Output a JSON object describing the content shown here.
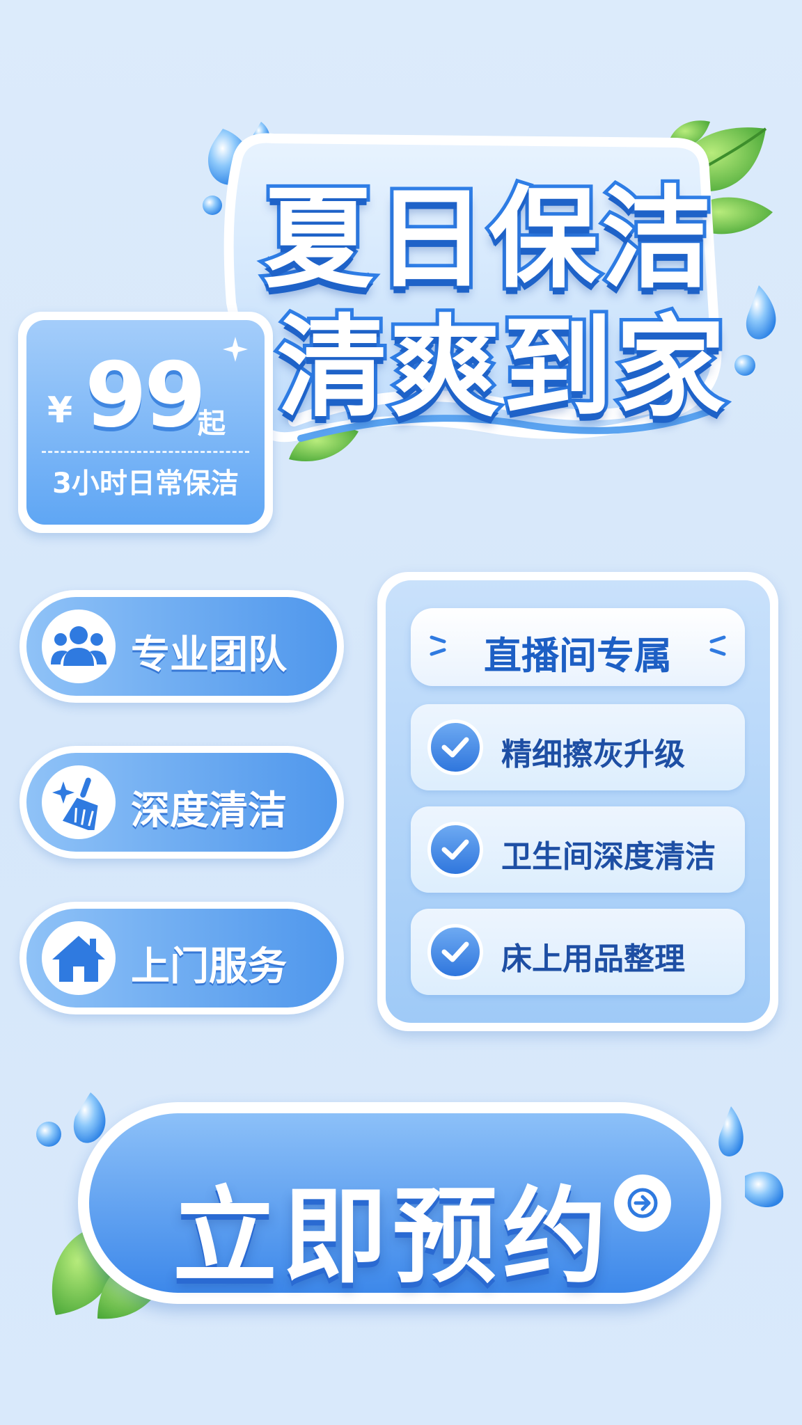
{
  "colors": {
    "accent": "#3d88ea",
    "accent_dark": "#1d5fc4",
    "background": "#d9e9fb",
    "leaf": "#6cc14a"
  },
  "title": {
    "line1": "夏日保洁",
    "line2": "清爽到家"
  },
  "price_card": {
    "currency": "¥",
    "amount": "99",
    "suffix": "起",
    "description": "3小时日常保洁"
  },
  "features": [
    {
      "label": "专业团队",
      "icon": "team-icon"
    },
    {
      "label": "深度清洁",
      "icon": "broom-sparkle-icon"
    },
    {
      "label": "上门服务",
      "icon": "home-icon"
    }
  ],
  "exclusive": {
    "title": "直播间专属",
    "perks": [
      {
        "label": "精细擦灰升级",
        "icon": "check-icon"
      },
      {
        "label": "卫生间深度清洁",
        "icon": "check-icon"
      },
      {
        "label": "床上用品整理",
        "icon": "check-icon"
      }
    ]
  },
  "cta": {
    "label": "立即预约",
    "icon": "arrow-right-icon"
  }
}
